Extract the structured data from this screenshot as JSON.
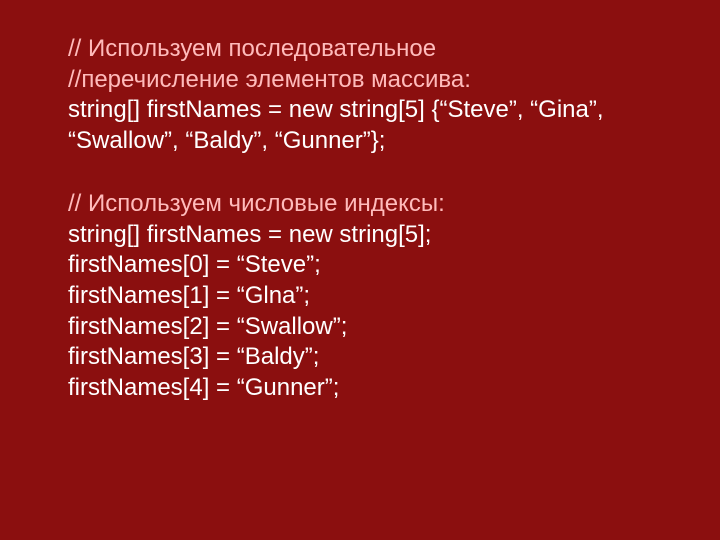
{
  "lines": {
    "c1a": "// Используем последовательное",
    "c1b": "//перечисление элементов массива:",
    "code1a": "string[] firstNames = new string[5] {“Steve”, “Gina”, “Swallow”, “Baldy”, “Gunner”};",
    "c2": "// Используем числовые индексы:",
    "code2": "string[] firstNames = new string[5];",
    "a0": "firstNames[0] = “Steve”;",
    "a1": "firstNames[1] = “Glna”;",
    "a2": "firstNames[2] = “Swallow”;",
    "a3": "firstNames[3] = “Baldy”;",
    "a4": "firstNames[4] = “Gunner”;"
  }
}
